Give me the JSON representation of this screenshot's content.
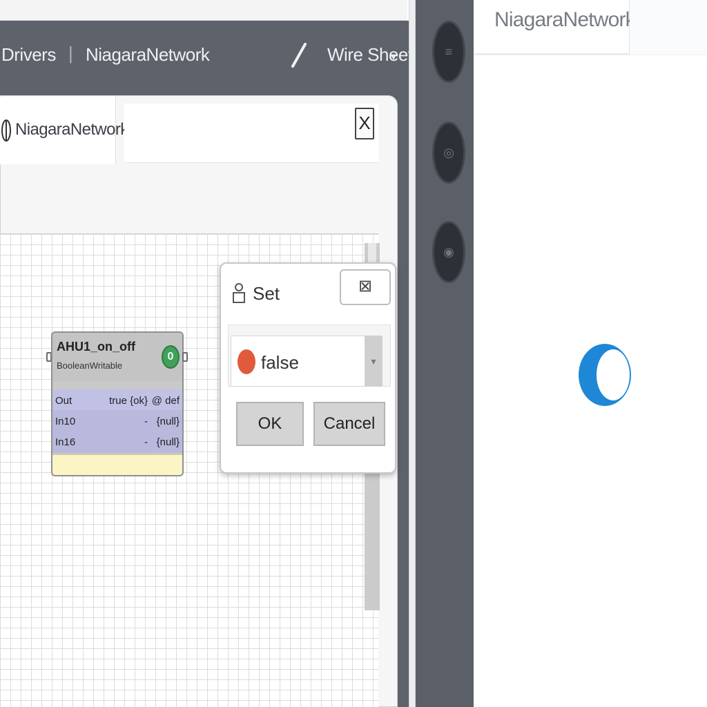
{
  "nav": {
    "drivers_label": "Drivers",
    "separator": "|",
    "niagara_label": "NiagaraNetwork",
    "wiresheet_label": "Wire Sheet",
    "wiresheet_caret": "▾"
  },
  "panel": {
    "tab_label": "NiagaraNetwork",
    "close_label": "X"
  },
  "node": {
    "title": "AHU1_on_off",
    "subtitle": "BooleanWritable",
    "status": "0",
    "rows": [
      {
        "name": "Out",
        "mid": "true {ok}",
        "value": "@ def"
      },
      {
        "name": "In10",
        "mid": "-",
        "value": "{null}"
      },
      {
        "name": "In16",
        "mid": "-",
        "value": "{null}"
      }
    ]
  },
  "dialog": {
    "title": "Set",
    "close_label": "⊠",
    "selected_value": "false",
    "ok_label": "OK",
    "cancel_label": "Cancel"
  },
  "right": {
    "tab_label": "NiagaraNetwork"
  },
  "colors": {
    "chrome": "#5d626b",
    "status_green": "#43a05a",
    "false_red": "#e05a3c",
    "spinner_blue": "#1e88d6",
    "node_slot": "#b9b9de",
    "node_footer": "#fbf5c6"
  },
  "icons": {
    "pen": "pen-icon",
    "panel_tab": "network-icon",
    "dialog": "action-icon",
    "spinner": "loading-spinner-icon"
  }
}
